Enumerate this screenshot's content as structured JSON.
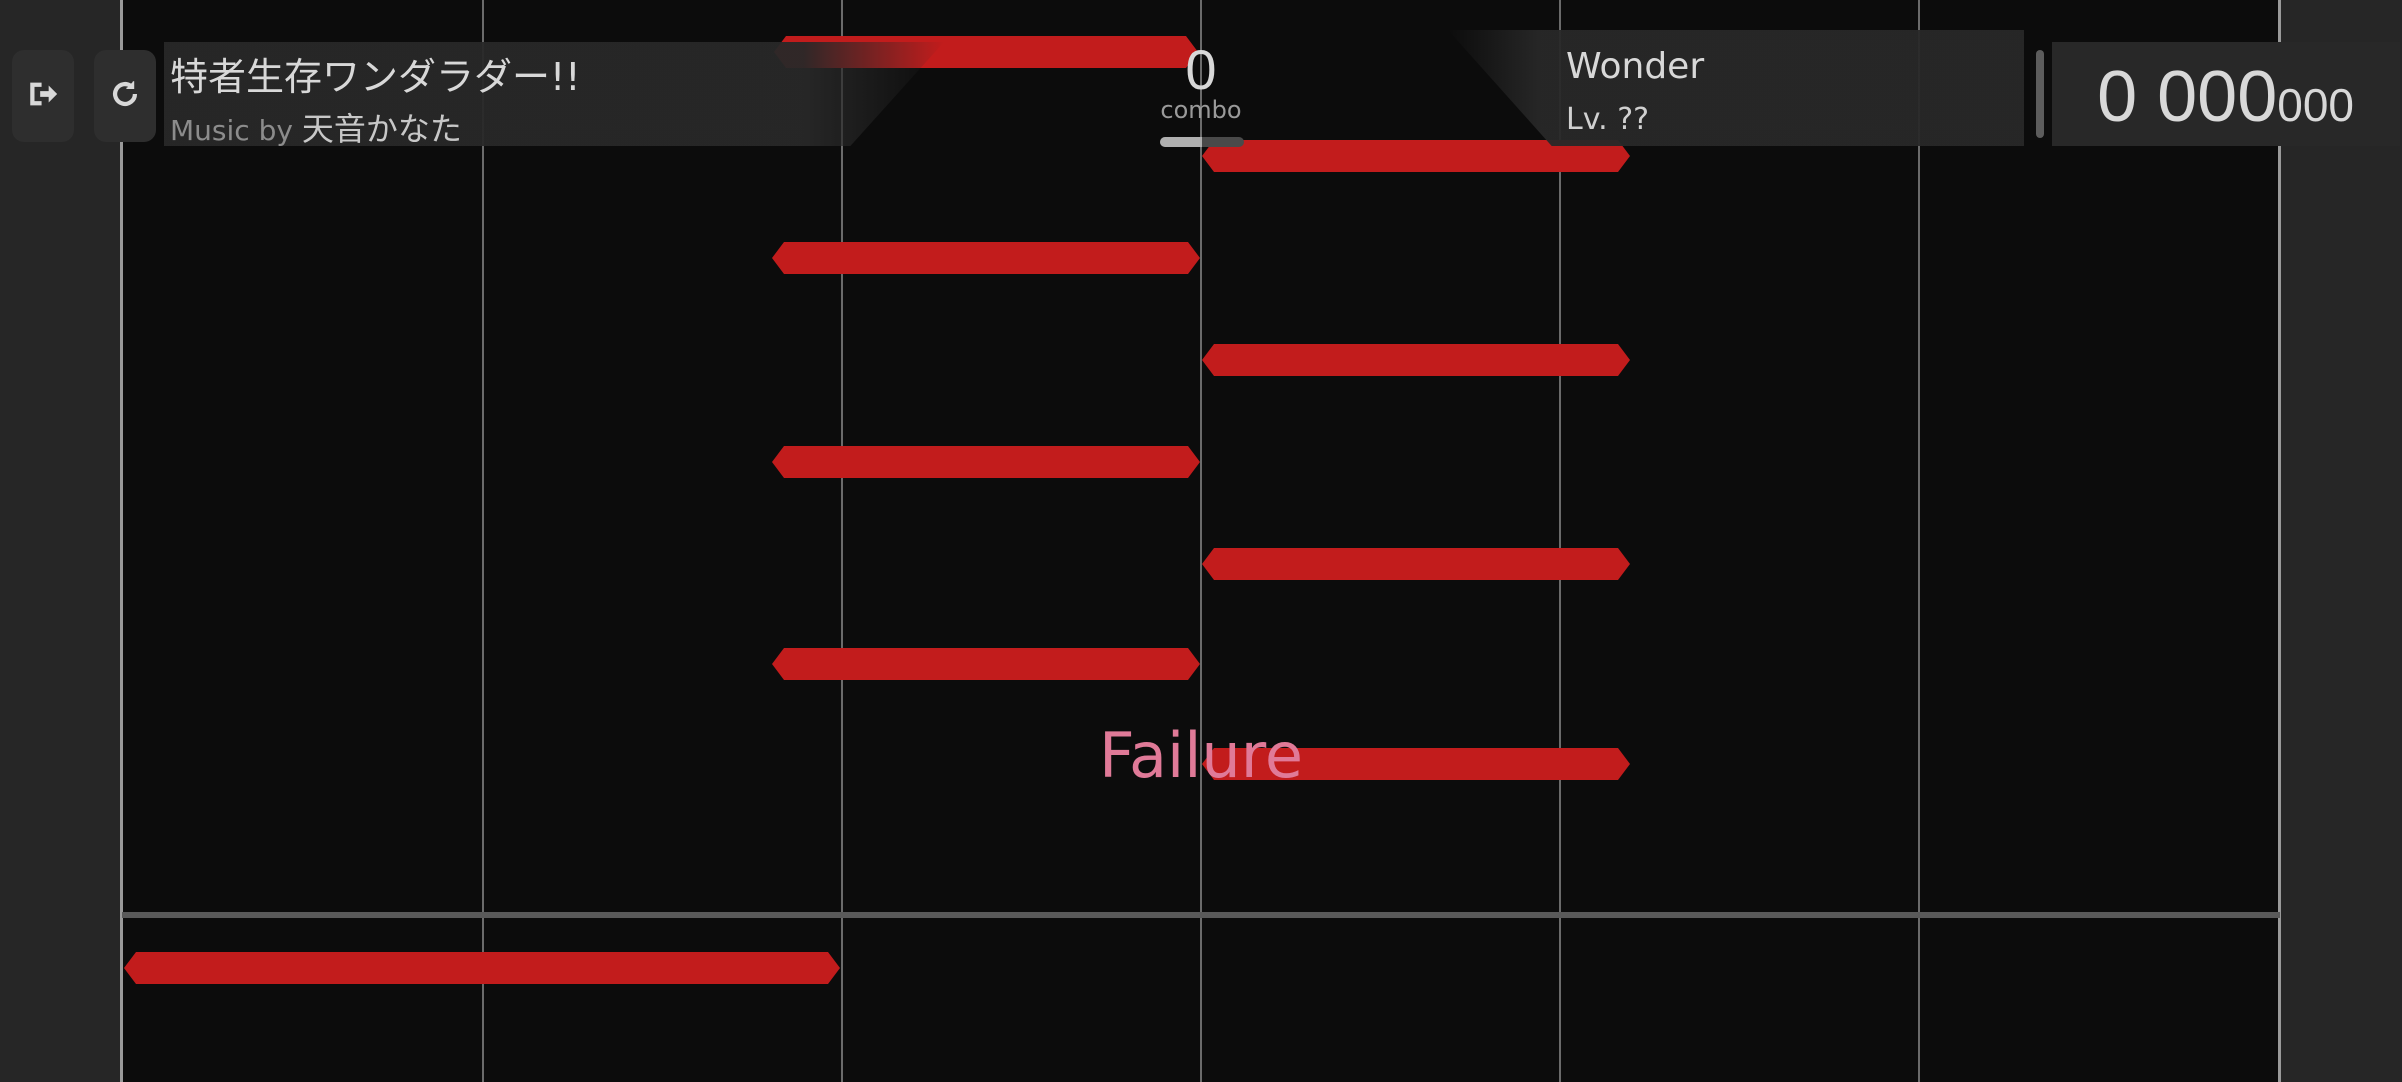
{
  "hud": {
    "exit_icon": "exit-icon",
    "retry_icon": "retry-icon",
    "song_title": "特者生存ワンダラダー!!",
    "artist_prefix": "Music by",
    "artist_name": "天音かなた",
    "combo_value": "0",
    "combo_label": "combo",
    "progress": 0.5,
    "difficulty_name": "Wonder",
    "difficulty_level": "Lv. ??",
    "score_main": "0 000",
    "score_minor": "000"
  },
  "judgement": "Failure",
  "colors": {
    "note": "#c21c1c",
    "judgement_text": "#e07a98",
    "hud_text": "#d8d8d8",
    "background": "#0c0c0c"
  },
  "lanes": 6,
  "notes": [
    {
      "lane": 2,
      "span": 2
    },
    {
      "lane": 3,
      "span": 1
    },
    {
      "lane": 2,
      "span": 1
    },
    {
      "lane": 3,
      "span": 1
    },
    {
      "lane": 2,
      "span": 1
    },
    {
      "lane": 3,
      "span": 1
    },
    {
      "lane": 2,
      "span": 1
    },
    {
      "lane": 3,
      "span": 1
    },
    {
      "lane": 0,
      "span": 2
    }
  ]
}
